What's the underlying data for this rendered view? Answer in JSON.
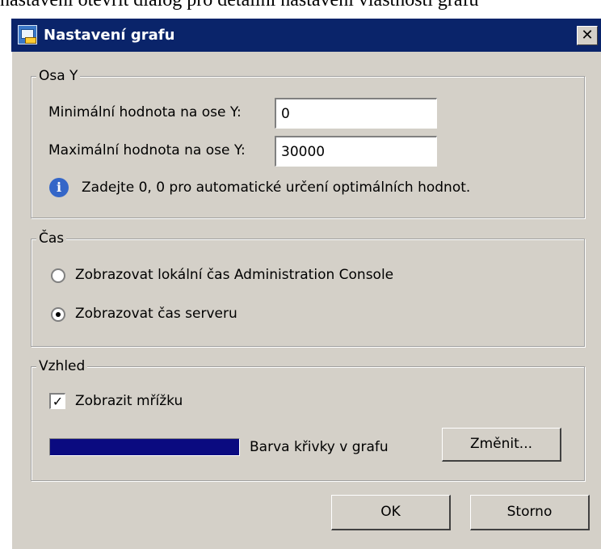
{
  "background_text": "nastavení otevřít dialog pro detailní nastavení vlastností grafu",
  "window": {
    "title": "Nastavení grafu",
    "close_label": "✕"
  },
  "axis_y": {
    "legend": "Osa Y",
    "min_label": "Minimální hodnota na ose Y:",
    "min_value": "0",
    "max_label": "Maximální hodnota na ose Y:",
    "max_value": "30000",
    "info_glyph": "i",
    "info_text": "Zadejte 0, 0 pro automatické určení optimálních hodnot."
  },
  "time": {
    "legend": "Čas",
    "options": [
      {
        "label": "Zobrazovat lokální čas Administration Console",
        "checked": false
      },
      {
        "label": "Zobrazovat čas serveru",
        "checked": true
      }
    ]
  },
  "appearance": {
    "legend": "Vzhled",
    "grid_label": "Zobrazit mřížku",
    "grid_checked": true,
    "check_glyph": "✓",
    "curve_color": "#0a0a80",
    "curve_color_label": "Barva křivky v grafu",
    "change_button": "Změnit..."
  },
  "buttons": {
    "ok": "OK",
    "cancel": "Storno"
  },
  "colors": {
    "titlebar": "#0a246a",
    "dialog_bg": "#d4d0c8"
  }
}
